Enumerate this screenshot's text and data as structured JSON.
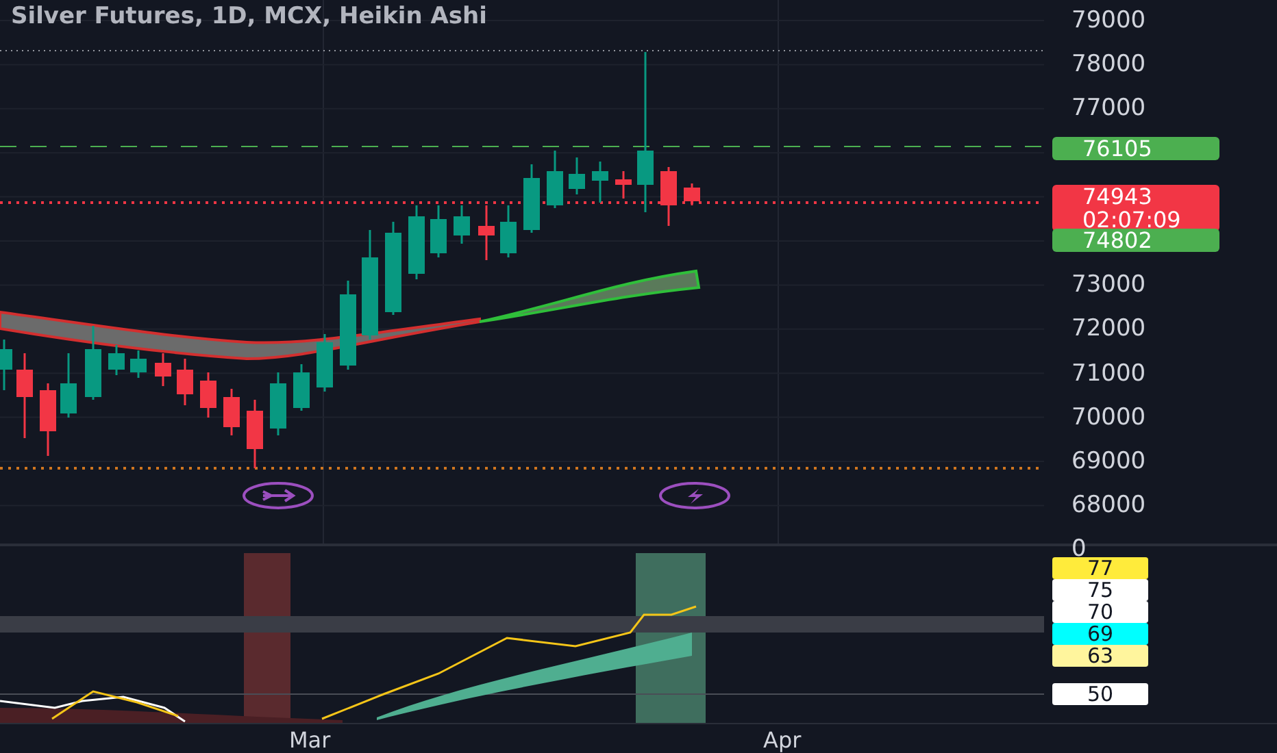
{
  "header": {
    "title": "Silver Futures, 1D, MCX, Heikin Ashi"
  },
  "price_axis": {
    "ticks": [
      "79000",
      "78000",
      "77000",
      "73000",
      "72000",
      "71000",
      "70000",
      "69000",
      "68000"
    ]
  },
  "price_labels": [
    {
      "kind": "single",
      "text": "76105",
      "color": "#4caf50"
    },
    {
      "kind": "double",
      "text": "74943",
      "subtext": "02:07:09",
      "color": "#f23645"
    },
    {
      "kind": "single",
      "text": "74802",
      "color": "#4caf50"
    }
  ],
  "event_markers": [
    {
      "kind": "split"
    },
    {
      "kind": "lightning"
    }
  ],
  "indicator_axis": {
    "ticks": [
      "0"
    ]
  },
  "indicator_labels": [
    {
      "text": "77",
      "color": "#ffeb3b"
    },
    {
      "text": "75",
      "color": "#ffffff"
    },
    {
      "text": "70",
      "color": "#ffffff"
    },
    {
      "text": "69",
      "color": "#00ffff"
    },
    {
      "text": "63",
      "color": "#fff59d"
    },
    {
      "text": "50",
      "color": "#ffffff"
    }
  ],
  "time_axis": {
    "labels": [
      "Mar",
      "Apr"
    ]
  }
}
